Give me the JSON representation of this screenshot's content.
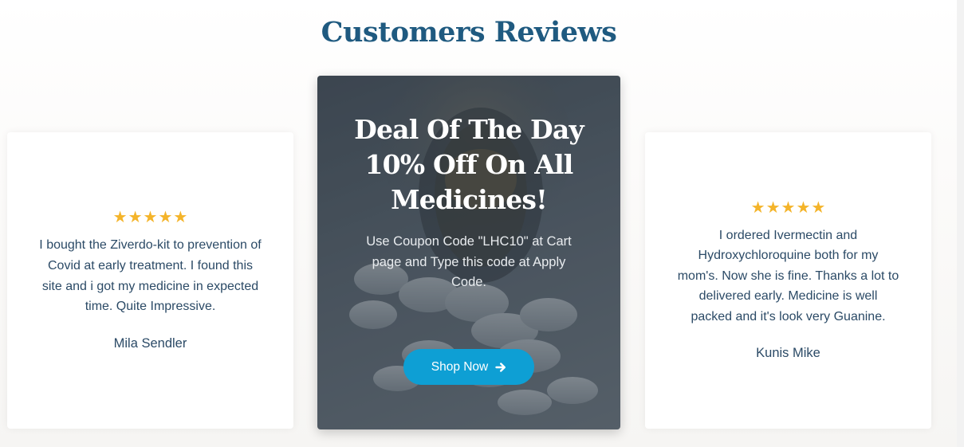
{
  "section": {
    "title": "Customers Reviews"
  },
  "reviews": [
    {
      "rating": 5,
      "text": "I bought the Ziverdo-kit to prevention of Covid at early treatment. I found this site and i got my medicine in expected time. Quite Impressive.",
      "name": "Mila Sendler"
    },
    {
      "rating": 5,
      "text": "I ordered Ivermectin and Hydroxychloroquine both for my mom's. Now she is fine. Thanks a lot to delivered early. Medicine is well packed and it's look very Guanine.",
      "name": "Kunis Mike"
    }
  ],
  "deal": {
    "heading": "Deal Of The Day 10% Off On All Medicines!",
    "text": "Use Coupon Code \"LHC10\" at Cart page and Type this code at Apply Code.",
    "button_label": "Shop Now",
    "button_icon": "arrow-right-icon"
  },
  "colors": {
    "title": "#1f5a80",
    "star": "#f4b42a",
    "button": "#0e9fd4",
    "review_text": "#2b4a66"
  }
}
